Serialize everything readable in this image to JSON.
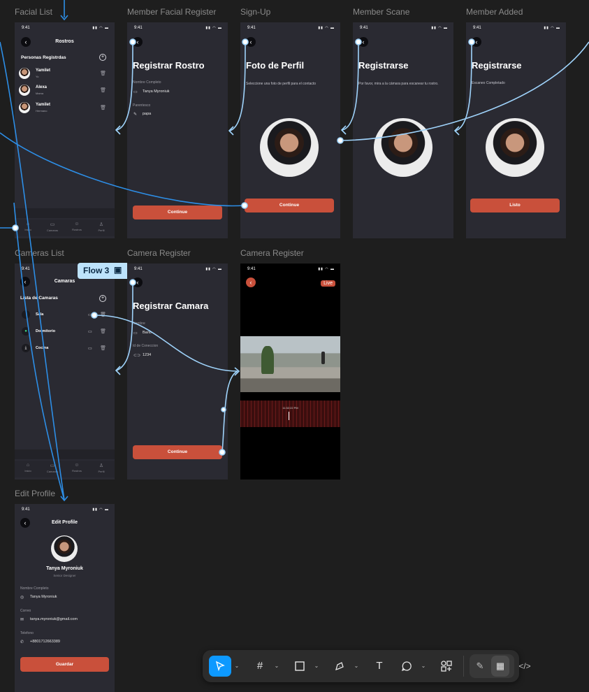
{
  "flows": {
    "badge": "Flow 3"
  },
  "frame_labels": {
    "facial_list": "Facial List",
    "member_facial_register": "Member Facial Register",
    "sign_up": "Sign-Up",
    "member_scane": "Member Scane",
    "member_added": "Member Added",
    "cameras_list": "Cameras List",
    "camera_register": "Camera Register",
    "camera_register_2": "Camera Register",
    "edit_profile": "Edit Profile"
  },
  "status_bar": {
    "time": "9:41",
    "icons": "▮▮ ◠ ▬"
  },
  "facial_list": {
    "title": "Rostros",
    "section": "Personas Registrdas",
    "people": [
      {
        "name": "Yamilet",
        "relation": "Yo"
      },
      {
        "name": "Alexa",
        "relation": "Mama"
      },
      {
        "name": "Yamilet",
        "relation": "Hermano"
      }
    ]
  },
  "tabs": [
    {
      "label": "Inicio",
      "icon": "home-icon",
      "glyph": "⌂"
    },
    {
      "label": "Camaras",
      "icon": "camera-icon",
      "glyph": "▭"
    },
    {
      "label": "Rostros",
      "icon": "face-icon",
      "glyph": "☺"
    },
    {
      "label": "Perfil",
      "icon": "user-icon",
      "glyph": "♙"
    }
  ],
  "member_facial_register": {
    "heading": "Registrar Rostro",
    "name_label": "Nombre Completo",
    "name_value": "Tanya Myroniuk",
    "relation_label": "Parentesco",
    "relation_value": "papa",
    "button": "Continue"
  },
  "sign_up": {
    "heading": "Foto de Perfil",
    "description": "Seleccione una foto de perfil para el contacto",
    "button": "Continue"
  },
  "member_scane": {
    "heading": "Registrarse",
    "description": "Por favor, mira a la cámara para escanear tu rostro."
  },
  "member_added": {
    "heading": "Registrarse",
    "description": "Escaneo Completado",
    "button": "Listo"
  },
  "cameras_list": {
    "title": "Camaras",
    "section": "Lista de Camaras",
    "cameras": [
      {
        "name": "Sala",
        "icon": "apple-icon",
        "glyph": ""
      },
      {
        "name": "Dormitorio",
        "icon": "android-icon",
        "glyph": "●"
      },
      {
        "name": "Cocina",
        "icon": "download-icon",
        "glyph": "⤓"
      }
    ]
  },
  "camera_register": {
    "heading": "Registrar Camara",
    "name_label": "Nombre",
    "name_value": "Bano",
    "id_label": "Id de Coneccion",
    "id_value": "1234",
    "button": "Continue"
  },
  "camera_live": {
    "badge": "Live",
    "timestamp": "11:32:22 PM"
  },
  "edit_profile": {
    "title": "Edit Profile",
    "name": "Tanya Myroniuk",
    "role": "Senior Designer",
    "fields": [
      {
        "label": "Nombre Completo",
        "value": "Tanya Myroniuk",
        "icon": "user-icon",
        "glyph": "◎"
      },
      {
        "label": "Correo",
        "value": "tanya.myroniuk@gmail.com",
        "icon": "mail-icon",
        "glyph": "✉"
      },
      {
        "label": "Telefono",
        "value": "+8801712663389",
        "icon": "phone-icon",
        "glyph": "✆"
      }
    ],
    "button": "Guardar"
  },
  "toolbar": {
    "tools": [
      {
        "name": "move-tool",
        "icon": "cursor-icon"
      },
      {
        "name": "frame-tool",
        "icon": "hash-icon"
      },
      {
        "name": "shape-tool",
        "icon": "rectangle-icon"
      },
      {
        "name": "pen-tool",
        "icon": "pen-icon"
      },
      {
        "name": "text-tool",
        "icon": "text-icon"
      },
      {
        "name": "comment-tool",
        "icon": "comment-icon"
      },
      {
        "name": "actions-tool",
        "icon": "components-icon"
      },
      {
        "name": "draw-mode",
        "icon": "pencil-icon"
      },
      {
        "name": "design-mode",
        "icon": "layout-icon"
      },
      {
        "name": "dev-mode",
        "icon": "code-icon"
      }
    ]
  },
  "colors": {
    "canvas": "#1e1e1e",
    "frame": "#2a2a32",
    "accent": "#c9503b",
    "connector": "#2d8ee6",
    "connector_light": "#9fd3fb",
    "flow_badge": "#bde3fb",
    "tool_active": "#0d99ff"
  }
}
